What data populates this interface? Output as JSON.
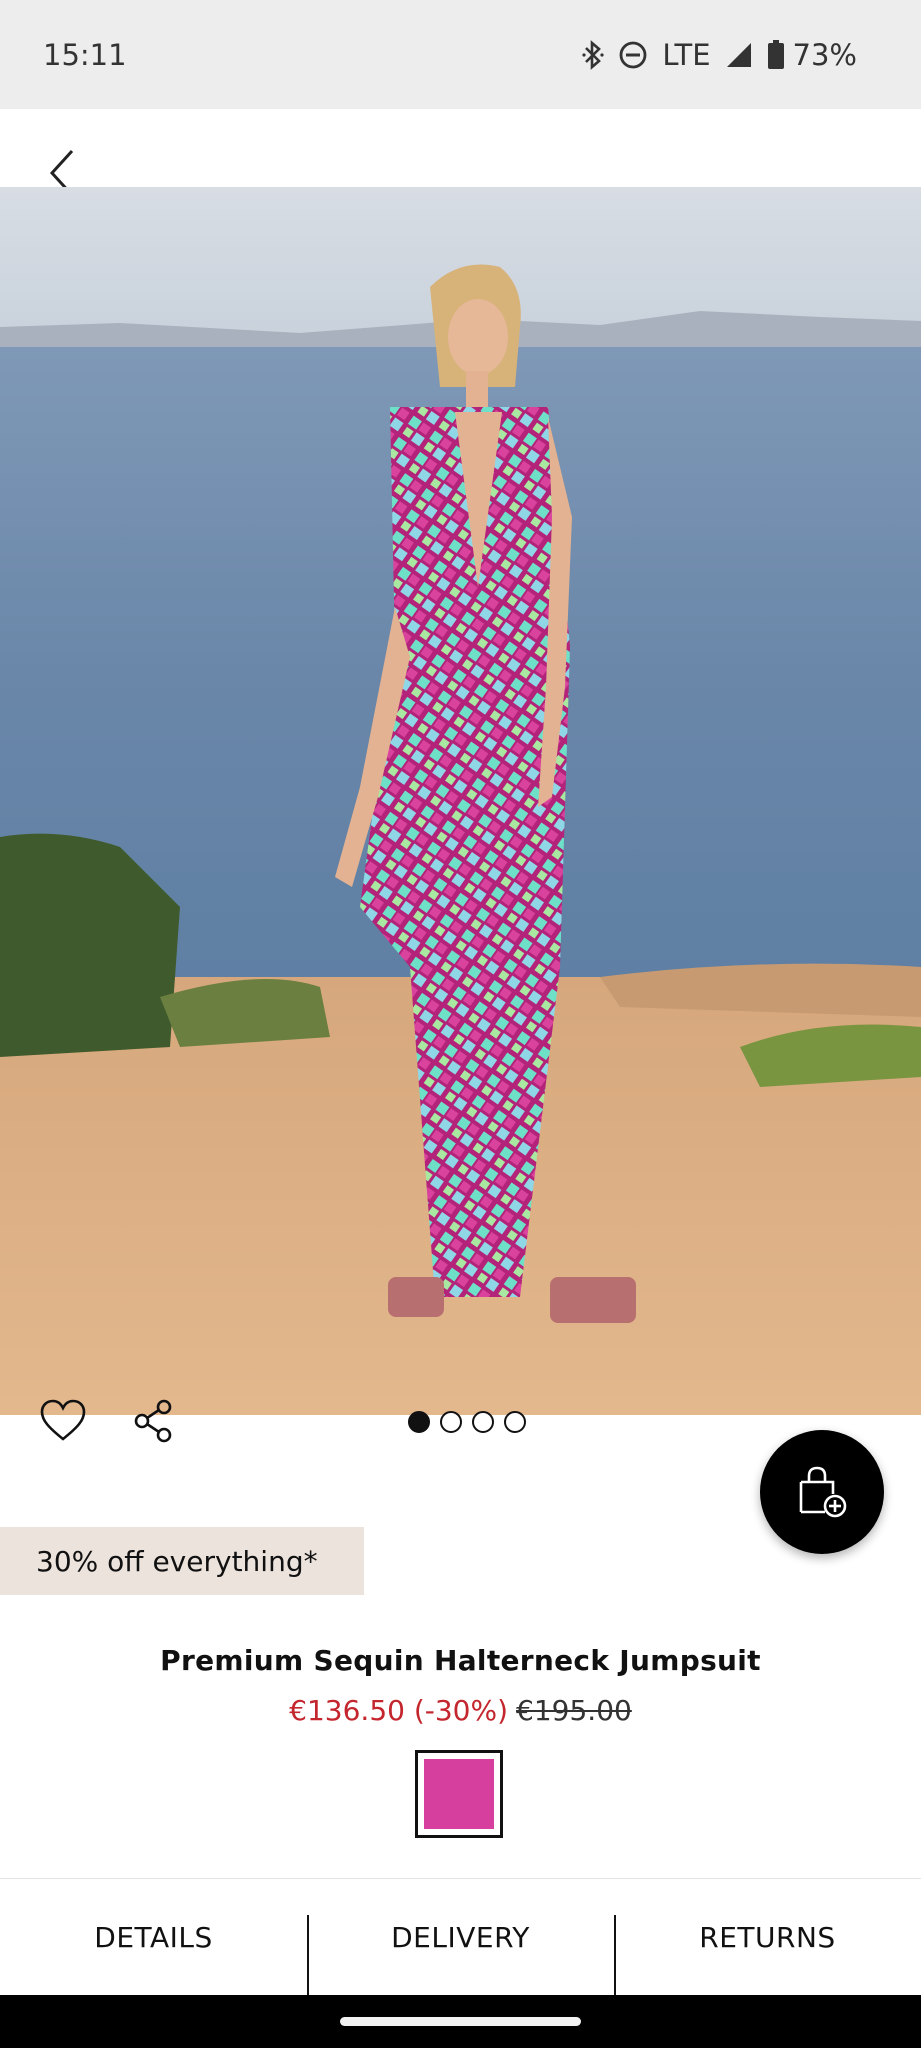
{
  "status_bar": {
    "time": "15:11",
    "network": "LTE",
    "battery": "73%",
    "icons": [
      "bluetooth-icon",
      "do-not-disturb-icon",
      "signal-icon",
      "battery-icon"
    ]
  },
  "header": {
    "back_icon": "chevron-left-icon"
  },
  "gallery": {
    "image_count": 4,
    "active_index": 0
  },
  "actions": {
    "favourite_icon": "heart-outline-icon",
    "share_icon": "share-icon",
    "bag_icon": "bag-add-icon"
  },
  "promo": {
    "text": "30% off everything*"
  },
  "product": {
    "title": "Premium Sequin Halterneck Jumpsuit",
    "price_sale": "€136.50 (-30%)",
    "price_original": "€195.00",
    "swatch_color": "#d63f9e"
  },
  "tabs": [
    {
      "label": "DETAILS"
    },
    {
      "label": "DELIVERY"
    },
    {
      "label": "RETURNS"
    }
  ],
  "colors": {
    "sale_red": "#c4262e",
    "promo_bg": "#ece3dc"
  }
}
